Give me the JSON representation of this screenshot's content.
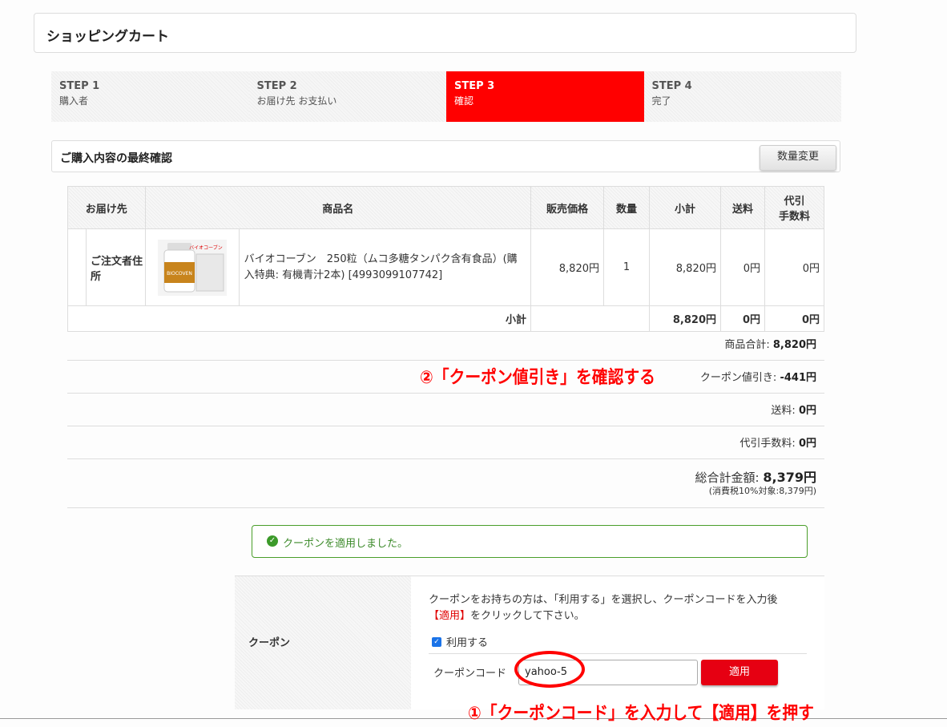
{
  "header": {
    "title": "ショッピングカート"
  },
  "steps": [
    {
      "num": "STEP 1",
      "label": "購入者"
    },
    {
      "num": "STEP 2",
      "label": "お届け先 お支払い"
    },
    {
      "num": "STEP 3",
      "label": "確認"
    },
    {
      "num": "STEP 4",
      "label": "完了"
    }
  ],
  "confirm": {
    "heading": "ご購入内容の最終確認",
    "qty_button": "数量変更"
  },
  "table": {
    "headers": {
      "dest": "お届け先",
      "product": "商品名",
      "price": "販売価格",
      "qty": "数量",
      "subtotal": "小計",
      "shipping": "送料",
      "cod_line1": "代引",
      "cod_line2": "手数料"
    },
    "row": {
      "dest": "ご注文者住所",
      "product": "バイオコーブン　250粒（ムコ多糖タンパク含有食品）(購入特典: 有機青汁2本) [4993099107742]",
      "price": "8,820円",
      "qty": "1",
      "subtotal": "8,820円",
      "shipping": "0円",
      "cod": "0円",
      "img_label": "バイオコーブン",
      "img_text": "BIOCOVEN"
    },
    "subtotal_row": {
      "label": "小計",
      "subtotal": "8,820円",
      "shipping": "0円",
      "cod": "0円"
    }
  },
  "summary": {
    "items_total_label": "商品合計:",
    "items_total": "8,820円",
    "coupon_label": "クーポン値引き:",
    "coupon": "-441円",
    "shipping_label": "送料:",
    "shipping": "0円",
    "cod_label": "代引手数料:",
    "cod": "0円",
    "grand_label": "総合計金額:",
    "grand": "8,379円",
    "tax_note": "(消費税10%対象:8,379円)"
  },
  "annotations": {
    "note2": "②「クーポン値引き」を確認する",
    "note1": "①「クーポンコード」を入力して【適用】を押す"
  },
  "success": {
    "message": "クーポンを適用しました。"
  },
  "coupon": {
    "label": "クーポン",
    "desc_prefix": "クーポンをお持ちの方は、「利用する」を選択し、クーポンコードを入力後",
    "desc_red": "【適用】",
    "desc_suffix": "をクリックして下さい。",
    "use_label": "利用する",
    "code_label": "クーポンコード",
    "code_value": "yahoo-5",
    "apply_button": "適用"
  },
  "colors": {
    "accent": "#ff0000",
    "success": "#4a9e2a",
    "button_red": "#e60012"
  }
}
